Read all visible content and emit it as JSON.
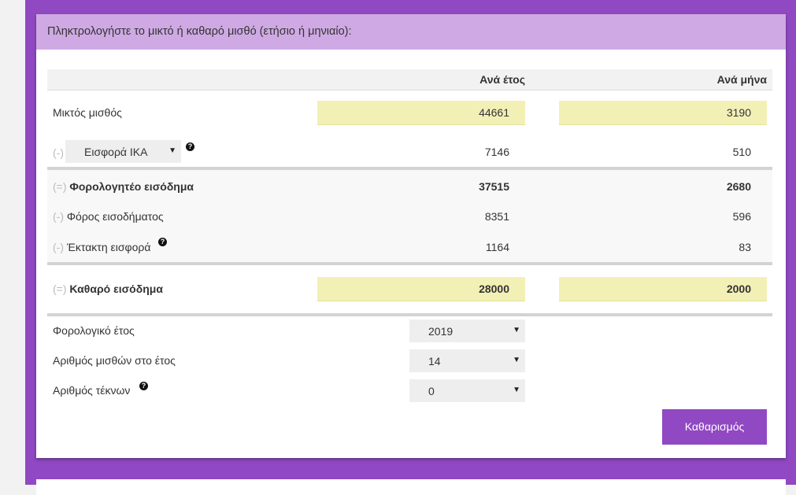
{
  "header": {
    "prompt": "Πληκτρολογήστε το μικτό ή καθαρό μισθό (ετήσιο ή μηνιαίο):"
  },
  "columns": {
    "year": "Ανά έτος",
    "month": "Ανά μήνα"
  },
  "gross": {
    "label": "Μικτός μισθός",
    "year": "44661",
    "month": "3190"
  },
  "ika": {
    "sign": "(-)",
    "label": "Εισφορά ΙΚΑ",
    "year": "7146",
    "month": "510"
  },
  "taxable": {
    "sign": "(=)",
    "label": "Φορολογητέο εισόδημα",
    "year": "37515",
    "month": "2680"
  },
  "income_tax": {
    "sign": "(-)",
    "label": "Φόρος εισοδήματος",
    "year": "8351",
    "month": "596"
  },
  "special": {
    "sign": "(-)",
    "label": "Έκτακτη εισφορά",
    "year": "1164",
    "month": "83"
  },
  "net": {
    "sign": "(=)",
    "label": "Καθαρό εισόδημα",
    "year": "28000",
    "month": "2000"
  },
  "settings": {
    "tax_year": {
      "label": "Φορολογικό έτος",
      "value": "2019"
    },
    "salaries": {
      "label": "Αριθμός μισθών στο έτος",
      "value": "14"
    },
    "children": {
      "label": "Αριθμός τέκνων",
      "value": "0"
    }
  },
  "clear_button": "Καθαρισμός",
  "colors": {
    "accent": "#9049c2",
    "header_bg": "#cfa9e3",
    "input_bg": "#f3f0b6"
  },
  "icons": {
    "help": "question-circle-icon",
    "dropdown": "caret-down-icon"
  }
}
